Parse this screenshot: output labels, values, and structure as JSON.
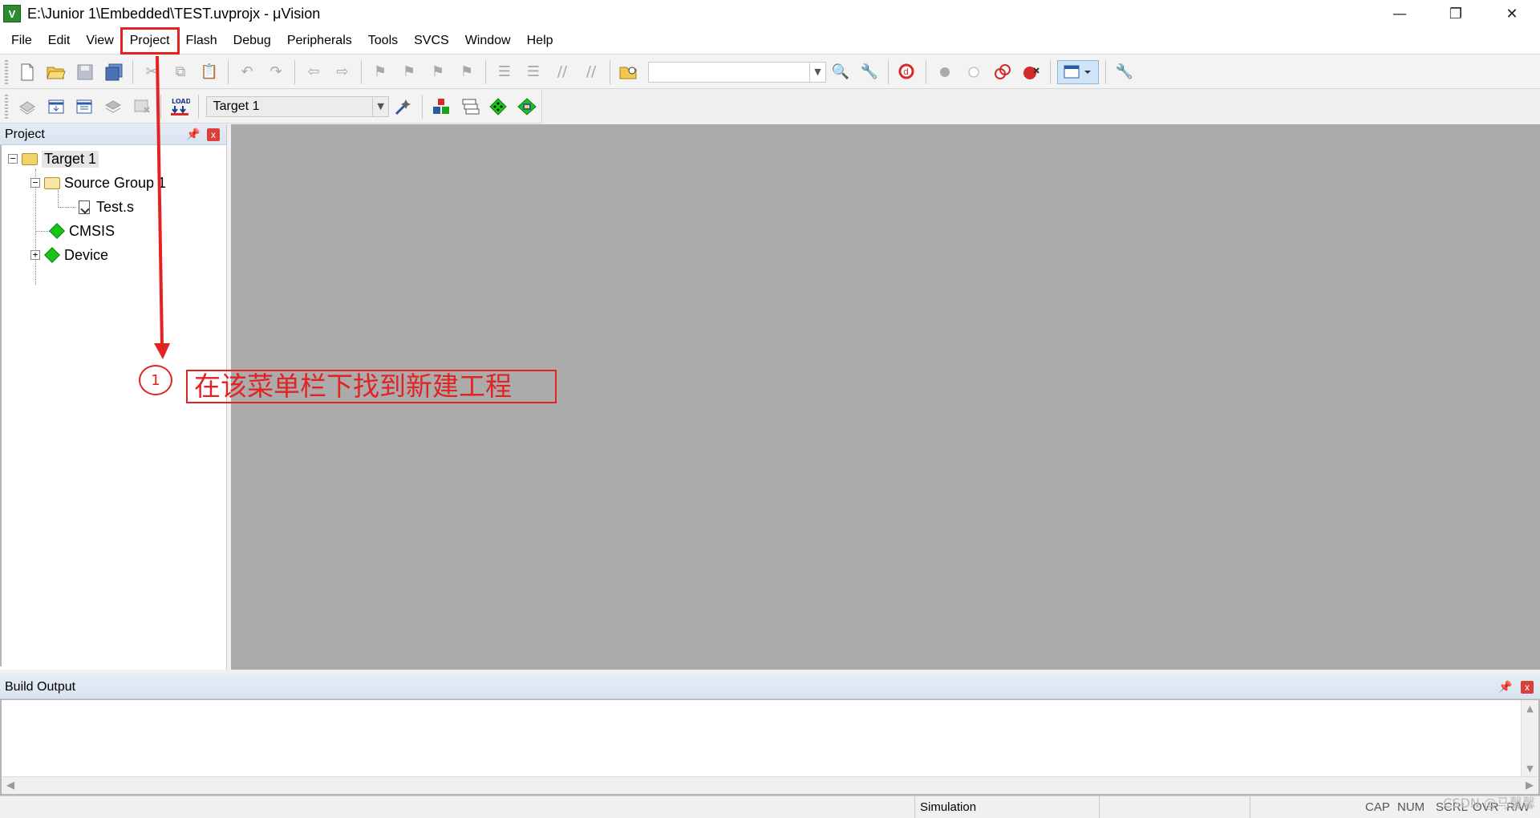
{
  "window": {
    "title": "E:\\Junior 1\\Embedded\\TEST.uvprojx - μVision",
    "app_icon_letter": "V",
    "controls": {
      "minimize": "—",
      "maximize": "❐",
      "close": "✕"
    }
  },
  "menu": {
    "items": [
      "File",
      "Edit",
      "View",
      "Project",
      "Flash",
      "Debug",
      "Peripherals",
      "Tools",
      "SVCS",
      "Window",
      "Help"
    ],
    "highlighted": "Project"
  },
  "toolbar2": {
    "target_select": "Target 1",
    "load_label": "LOAD"
  },
  "project_panel": {
    "title": "Project",
    "pin": "📌",
    "close": "x",
    "tree": {
      "target": "Target 1",
      "group": "Source Group 1",
      "file": "Test.s",
      "cmsis": "CMSIS",
      "device": "Device",
      "collapse": "−",
      "expand": "+"
    }
  },
  "build_output": {
    "title": "Build Output",
    "pin": "📌",
    "close": "x"
  },
  "statusbar": {
    "mode": "Simulation",
    "indicators": [
      "CAP",
      "NUM",
      "SCRL",
      "OVR",
      "R/W"
    ]
  },
  "watermark": "CSDN @马馨馨",
  "annotation": {
    "step": "1",
    "text": "在该菜单栏下找到新建工程"
  },
  "colors": {
    "annotation": "#e32222",
    "editor_bg": "#ababab",
    "panel_header": "#dce5f0",
    "green_icon": "#19c419",
    "folder": "#f2d36a"
  }
}
